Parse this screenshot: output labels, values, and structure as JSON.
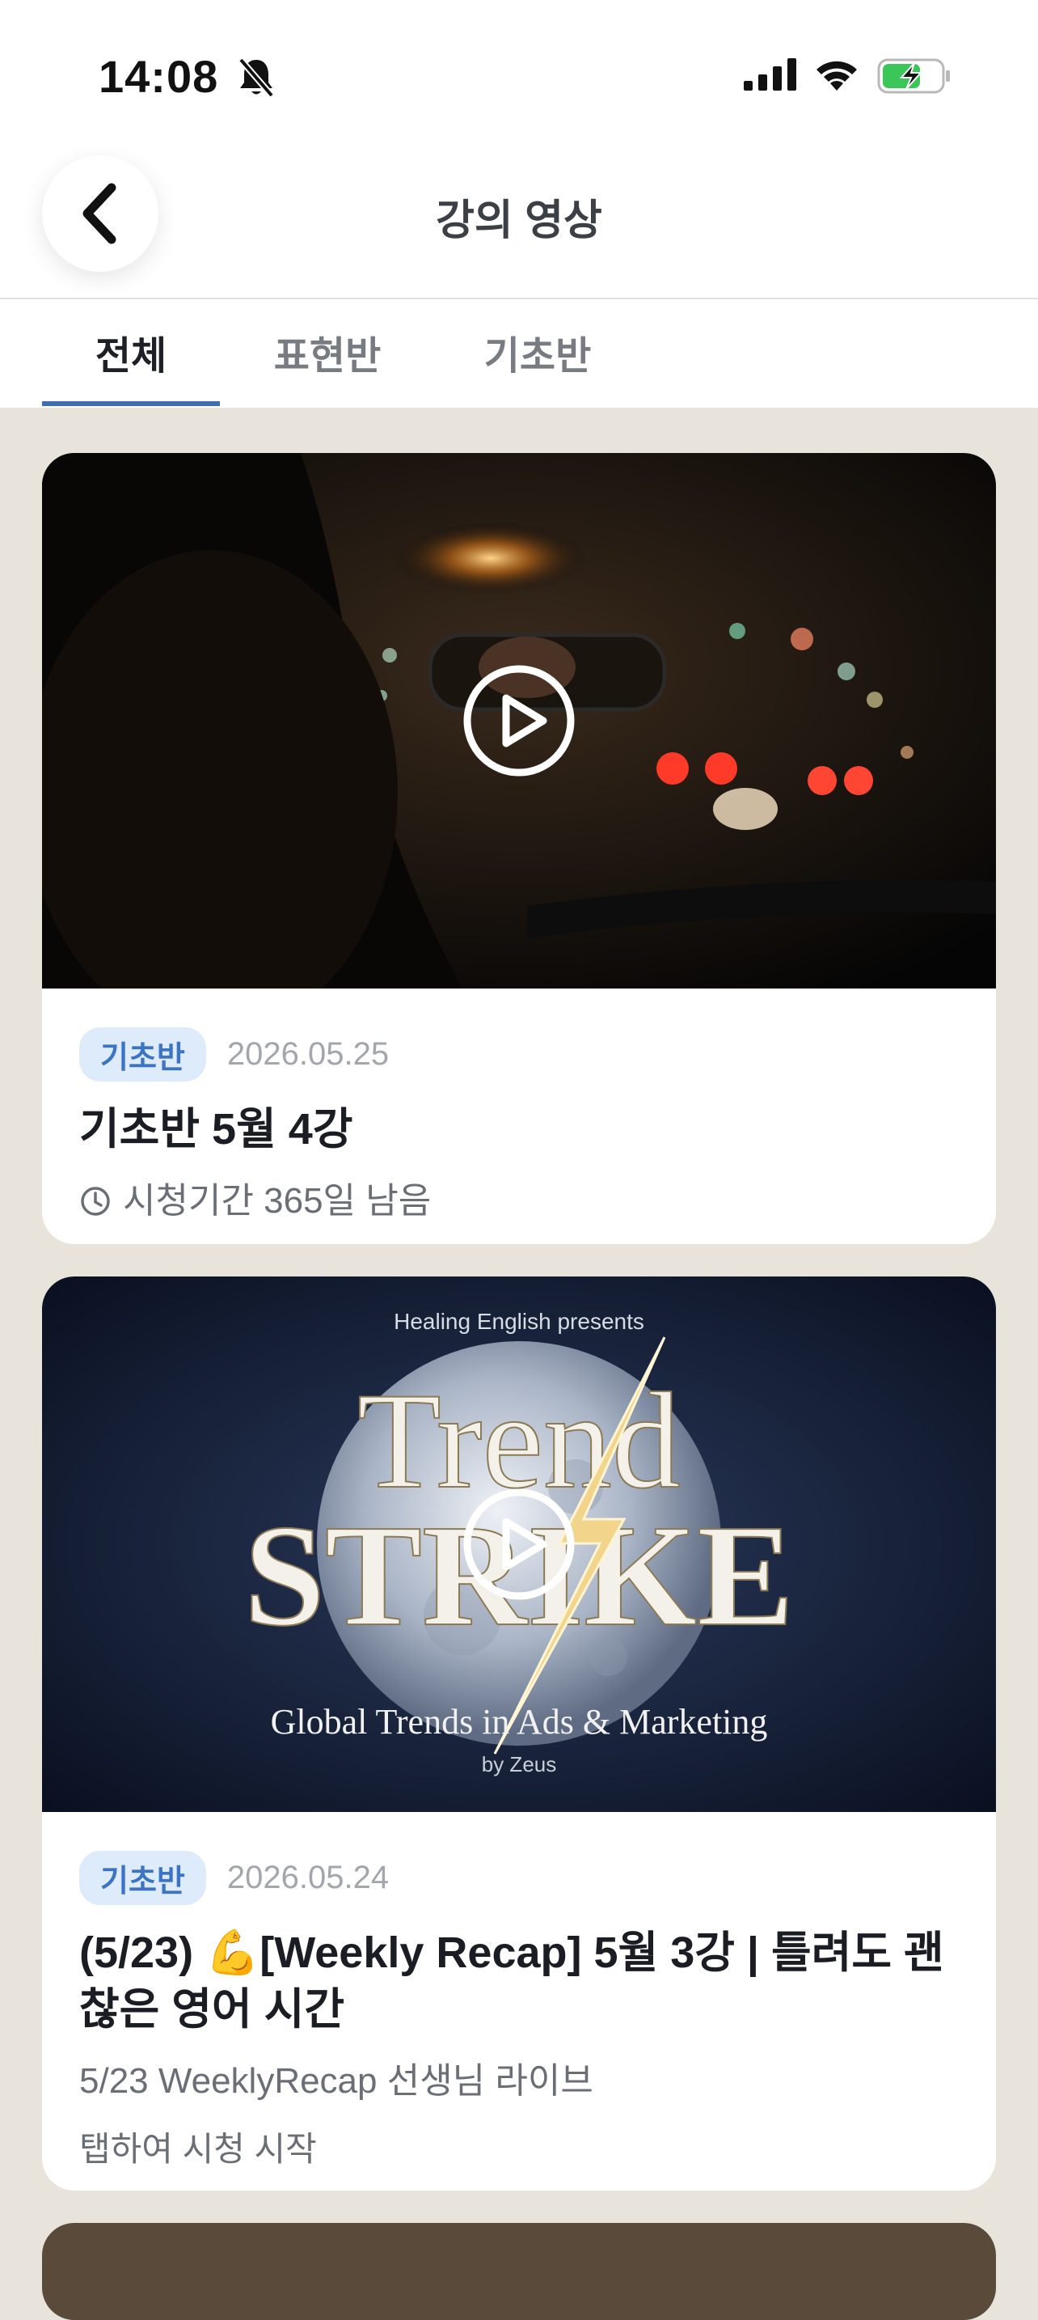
{
  "status": {
    "time": "14:08",
    "icons": [
      "bell-muted-icon",
      "cellular-signal-icon",
      "wifi-icon",
      "battery-charging-icon"
    ]
  },
  "nav": {
    "title": "강의 영상",
    "back_icon": "chevron-left-icon"
  },
  "tabs": [
    {
      "label": "전체",
      "active": true
    },
    {
      "label": "표현반",
      "active": false
    },
    {
      "label": "기초반",
      "active": false
    }
  ],
  "cards": [
    {
      "thumbnail": "night-car-dashboard-photo",
      "badge": "기초반",
      "date": "2026.05.25",
      "title": "기초반 5월 4강",
      "subtitle": "시청기간 365일 남음",
      "subtitle_icon": "clock-icon"
    },
    {
      "thumbnail": "trend-strike-poster",
      "thumb_text": {
        "presents": "Healing English presents",
        "line1": "Trend",
        "line2": "STRIKE",
        "tagline": "Global Trends in Ads & Marketing",
        "byline": "by Zeus"
      },
      "badge": "기초반",
      "date": "2026.05.24",
      "title": "(5/23) 💪[Weekly Recap] 5월 3강 | 틀려도 괜찮은 영어 시간",
      "subtitle": "5/23 WeeklyRecap 선생님 라이브",
      "note": "탭하여 시청 시작"
    }
  ],
  "colors": {
    "background": "#E8E3DB",
    "accent": "#3E6FB0",
    "badge_bg": "#DDEBFB",
    "badge_text": "#3C74C5"
  }
}
